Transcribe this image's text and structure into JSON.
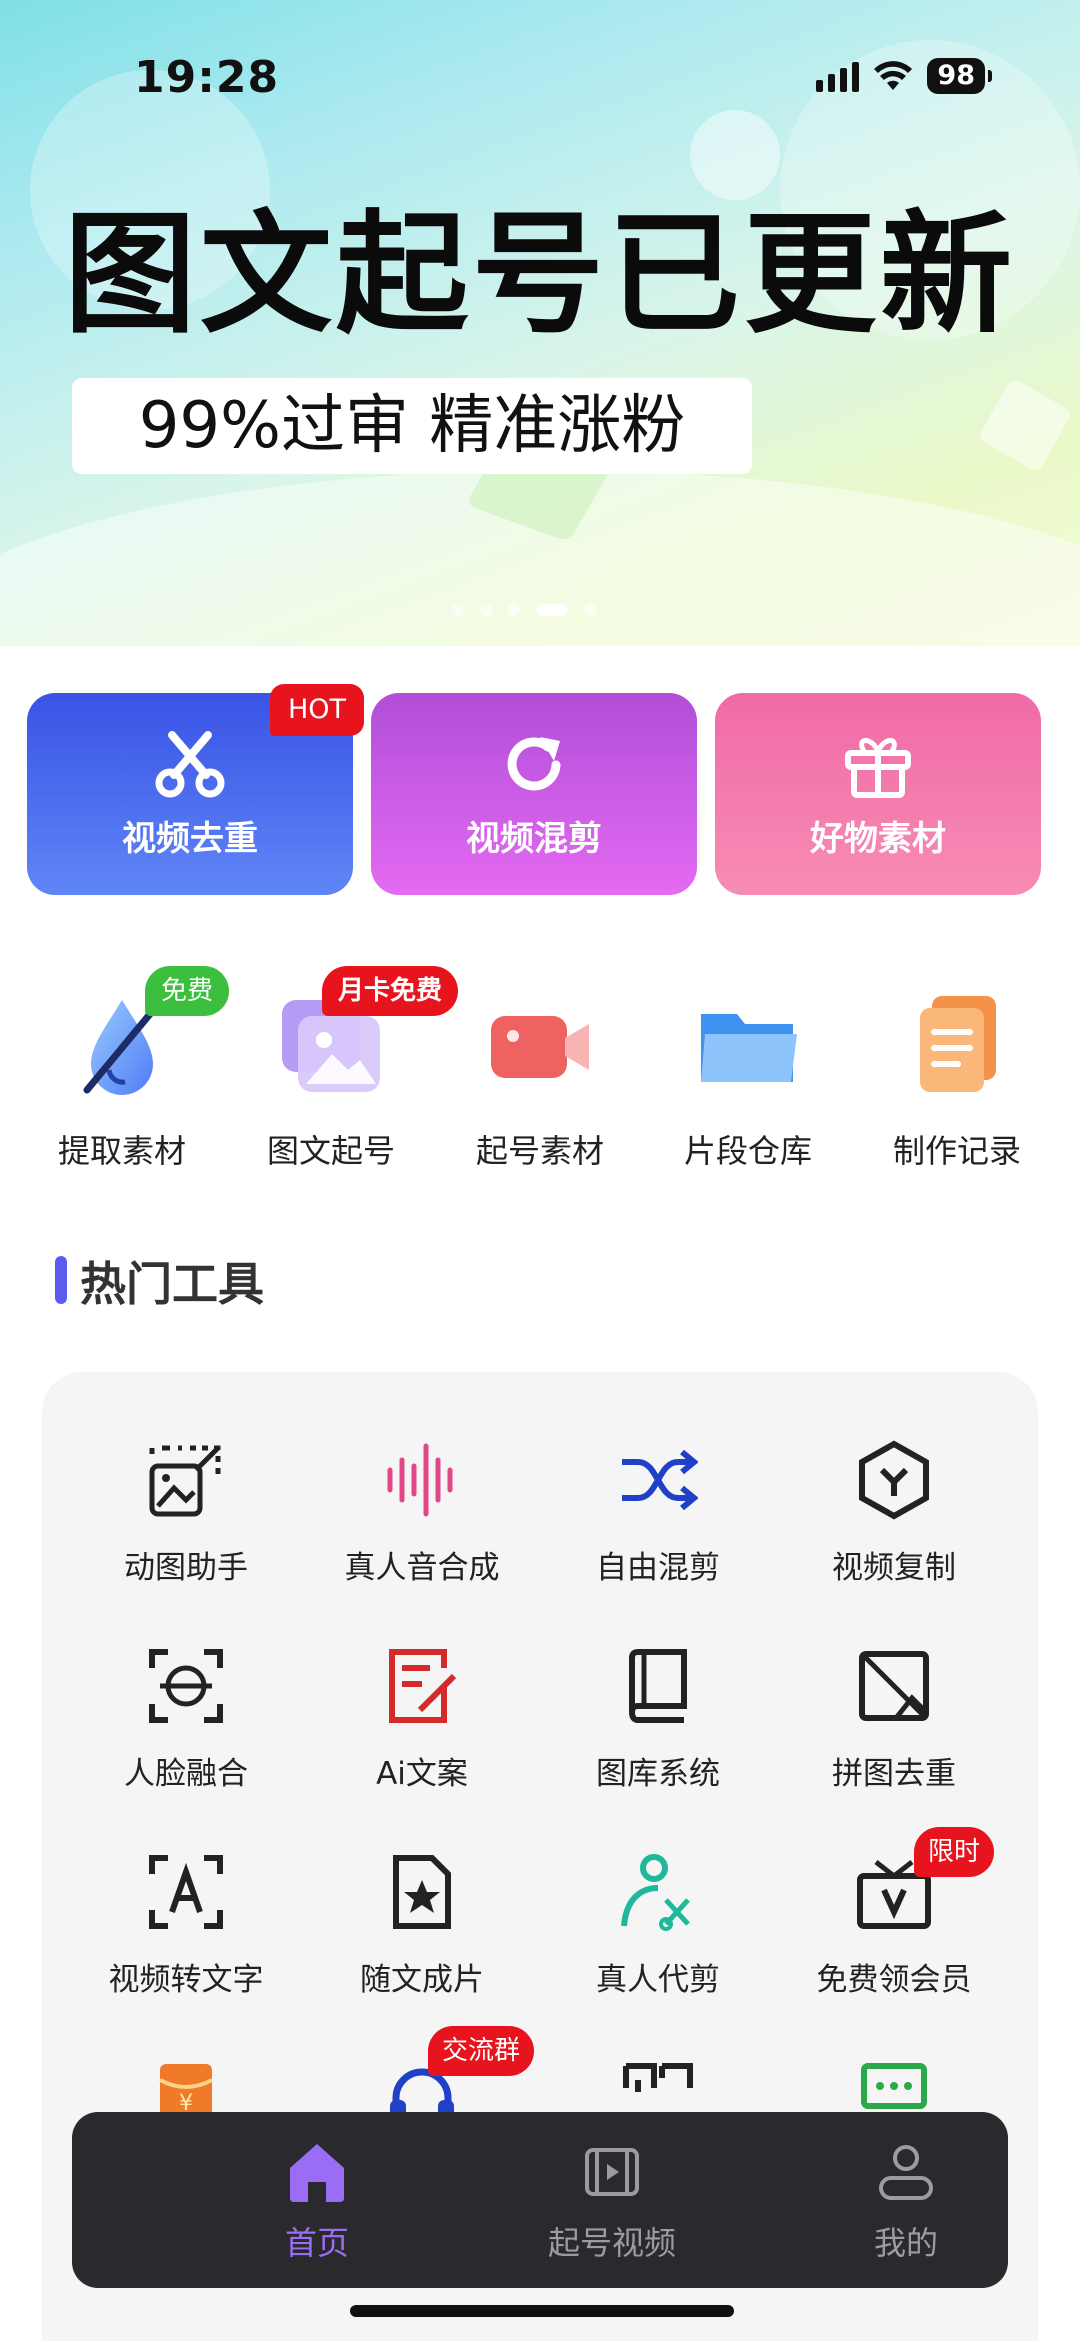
{
  "status_bar": {
    "time": "19:28",
    "battery": "98"
  },
  "banner": {
    "title": "图文起号已更新",
    "subtitle": "99%过审 精准涨粉"
  },
  "feature_cards": [
    {
      "label": "视频去重",
      "badge": "HOT"
    },
    {
      "label": "视频混剪"
    },
    {
      "label": "好物素材"
    }
  ],
  "quick_actions": [
    {
      "label": "提取素材",
      "badge": "免费"
    },
    {
      "label": "图文起号",
      "badge": "月卡免费"
    },
    {
      "label": "起号素材"
    },
    {
      "label": "片段仓库"
    },
    {
      "label": "制作记录"
    }
  ],
  "section": {
    "title": "热门工具"
  },
  "tools": [
    {
      "label": "动图助手"
    },
    {
      "label": "真人音合成"
    },
    {
      "label": "自由混剪"
    },
    {
      "label": "视频复制"
    },
    {
      "label": "人脸融合"
    },
    {
      "label": "Ai文案"
    },
    {
      "label": "图库系统"
    },
    {
      "label": "拼图去重"
    },
    {
      "label": "视频转文字"
    },
    {
      "label": "随文成片"
    },
    {
      "label": "真人代剪"
    },
    {
      "label": "免费领会员",
      "badge": "限时"
    }
  ],
  "partial_tools_badge": "交流群",
  "tabbar": [
    {
      "label": "首页",
      "active": true
    },
    {
      "label": "起号视频"
    },
    {
      "label": "我的"
    }
  ],
  "colors": {
    "accent": "#9a6df4",
    "badge_red": "#e8141d",
    "badge_green": "#3cbf3f",
    "section_bar": "#5a5cf0"
  }
}
